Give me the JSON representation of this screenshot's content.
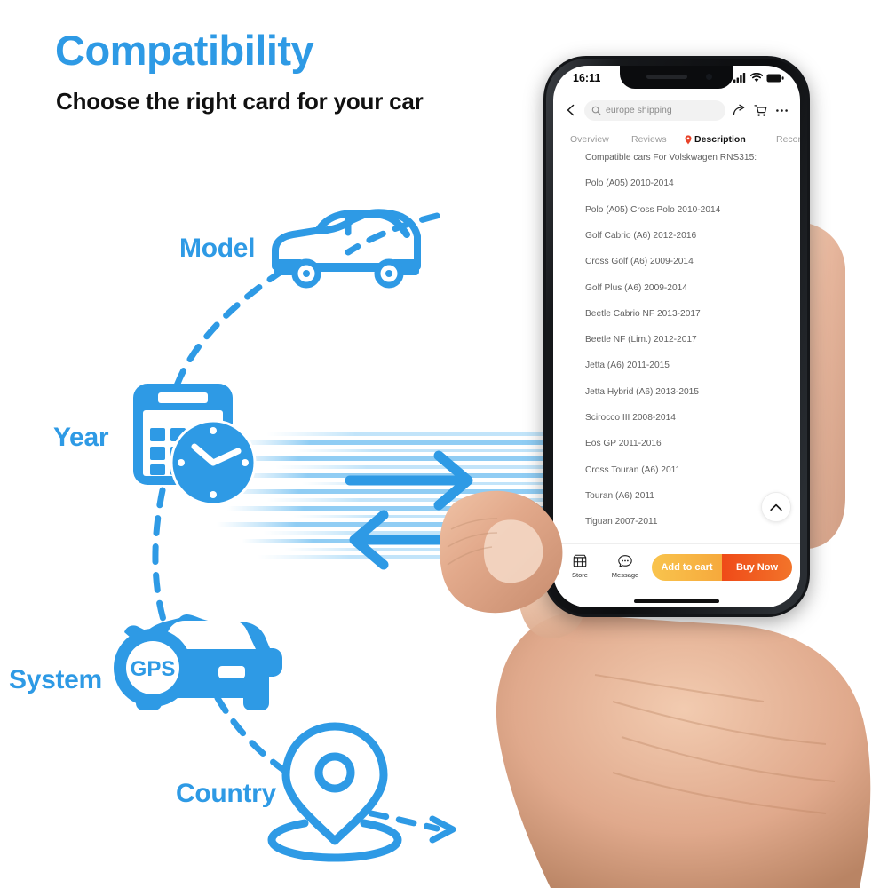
{
  "header": {
    "title": "Compatibility",
    "subtitle": "Choose the right card for your car",
    "title_color": "#2e9ae5"
  },
  "diagram": {
    "accent_color": "#2e9ae5",
    "nodes": [
      {
        "label": "Model",
        "icon": "car-side-icon"
      },
      {
        "label": "Year",
        "icon": "calendar-clock-icon"
      },
      {
        "label": "System",
        "icon": "gps-car-icon",
        "badge": "GPS"
      },
      {
        "label": "Country",
        "icon": "map-pin-icon"
      }
    ],
    "arrows": [
      {
        "direction": "right",
        "icon": "arrow-right-icon"
      },
      {
        "direction": "left",
        "icon": "arrow-left-icon"
      }
    ]
  },
  "phone": {
    "status_bar": {
      "time": "16:11",
      "signal_icon": "cellular-bars-icon",
      "wifi_icon": "wifi-icon",
      "battery_icon": "battery-full-icon"
    },
    "top_bar": {
      "back_icon": "chevron-left-icon",
      "search_icon": "search-icon",
      "search_value": "europe shipping",
      "share_icon": "share-arrow-icon",
      "cart_icon": "shopping-cart-icon",
      "more_icon": "more-horizontal-icon"
    },
    "tabs": [
      {
        "label": "Overview",
        "active": false
      },
      {
        "label": "Reviews",
        "active": false
      },
      {
        "label": "Description",
        "active": true,
        "icon": "location-pin-icon",
        "icon_color": "#e8432a"
      },
      {
        "label": "Recom",
        "active": false,
        "truncated": true
      }
    ],
    "description": {
      "heading": "Compatible cars For Volskwagen RNS315:",
      "items": [
        "Polo (A05) 2010-2014",
        "Polo (A05) Cross Polo 2010-2014",
        "Golf Cabrio (A6) 2012-2016",
        "Cross Golf (A6) 2009-2014",
        "Golf Plus (A6) 2009-2014",
        "Beetle Cabrio NF 2013-2017",
        "Beetle NF (Lim.) 2012-2017",
        "Jetta (A6) 2011-2015",
        "Jetta Hybrid (A6) 2013-2015",
        "Scirocco III 2008-2014",
        "Eos GP 2011-2016",
        "Cross Touran (A6) 2011",
        "Touran (A6) 2011",
        "Tiguan 2007-2011"
      ]
    },
    "scroll_top_icon": "chevron-up-icon",
    "action_bar": {
      "store_label": "Store",
      "store_icon": "store-icon",
      "message_label": "Message",
      "message_icon": "message-bubble-icon",
      "add_to_cart_label": "Add to cart",
      "buy_now_label": "Buy Now",
      "add_to_cart_color": "#f6a93c",
      "buy_now_color": "#ef4a18"
    }
  }
}
